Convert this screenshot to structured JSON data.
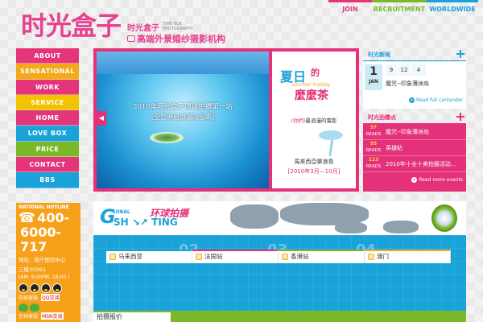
{
  "header": {
    "logo_cn": "时光盒子",
    "logo_small_cn": "时光盒子",
    "logo_en": "TIME BOX PHOTOGRAPHY",
    "tagline": "高端外景婚纱摄影机构"
  },
  "topnav": {
    "join": "JOIN",
    "recruitment": "RECRUITMENT",
    "worldwide": "WORLDWIDE"
  },
  "menu": [
    {
      "label": "ABOUT",
      "color": "#e4347a"
    },
    {
      "label": "SENSATIONAL",
      "color": "#f3a91a"
    },
    {
      "label": "WORK",
      "color": "#e4347a"
    },
    {
      "label": "SERVICE",
      "color": "#f3c300"
    },
    {
      "label": "HOME",
      "color": "#e4347a"
    },
    {
      "label": "LOVE BOX",
      "color": "#1aa3d9"
    },
    {
      "label": "PRICE",
      "color": "#7ab827"
    },
    {
      "label": "CONTACT",
      "color": "#e4347a"
    },
    {
      "label": "BBS",
      "color": "#1aa3d9"
    }
  ],
  "hotline": {
    "label": "NATIONAL HOTLINE",
    "num1": "400-",
    "num2": "6000-717",
    "addr1": "地址：南宁国贸中心",
    "addr2": "三楼3C061",
    "hours": "(AM: 9:00PM- 18:00 )",
    "online_service": "在线客服",
    "online_tag": "QQ交谈",
    "msn_service": "在线客服",
    "msn_tag": "MSN交谈"
  },
  "banner": {
    "title1": "2010年時光盒子環球拍攝第一站",
    "title2": "[全亞洲最浪漫的島嶼]",
    "summer": "夏日",
    "de": "的",
    "summer_en": "summer holiday",
    "mmc": "麼麼茶",
    "desc_highlight": "(你們)",
    "desc": "最浪漫的電影",
    "trip": "馬來西亞樂浪島",
    "date": "[2010年3月—10月]"
  },
  "news": {
    "title": "时光新闻",
    "day": "1",
    "month": "JAN",
    "dates": [
      "9",
      "12",
      "4"
    ],
    "event": "魔咒--印象薄洲岛",
    "full_link": "Read full canlander"
  },
  "activity": {
    "title": "时光劲爆点",
    "items": [
      {
        "count": "57",
        "reads": "READS",
        "text": "魔咒--印象薄洲岛"
      },
      {
        "count": "95",
        "reads": "READS",
        "text": "英雄帖"
      },
      {
        "count": "123",
        "reads": "READS",
        "text": "2010年十全十美拍摄活动..."
      }
    ],
    "more_link": "Read more events"
  },
  "global": {
    "g": "G",
    "lbl": "LOBAL",
    "sh": "SH ↘↗ TING",
    "cn": "环球拍摄",
    "numbers": [
      "02",
      "03",
      "04"
    ],
    "tabs": [
      "马来西亚",
      "法国站",
      "香港站",
      "澳门"
    ],
    "price_label": "拍摄报价"
  }
}
